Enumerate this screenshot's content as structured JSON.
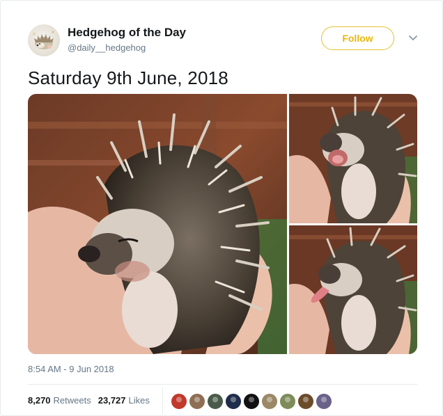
{
  "account": {
    "name": "Hedgehog of the Day",
    "handle": "@daily__hedgehog",
    "avatar_icon": "hedgehog-avatar-icon"
  },
  "follow_button": {
    "label": "Follow",
    "color": "#e8b80d"
  },
  "menu_icon": "chevron-down-icon",
  "tweet": {
    "text": "Saturday 9th June, 2018",
    "timestamp": "8:54 AM - 9 Jun 2018"
  },
  "media": {
    "photos": [
      "hedgehog-photo-sleeping",
      "hedgehog-photo-yawning",
      "hedgehog-photo-tongue-out"
    ]
  },
  "stats": {
    "retweets_count": "8,270",
    "retweets_label": "Retweets",
    "likes_count": "23,727",
    "likes_label": "Likes"
  },
  "likers": [
    {
      "color": "#c0392b"
    },
    {
      "color": "#8e6e53"
    },
    {
      "color": "#4a5a4a"
    },
    {
      "color": "#1f2d4a"
    },
    {
      "color": "#111111"
    },
    {
      "color": "#9a8866"
    },
    {
      "color": "#7d8c5a"
    },
    {
      "color": "#6b4b2a"
    },
    {
      "color": "#6a6288"
    }
  ]
}
